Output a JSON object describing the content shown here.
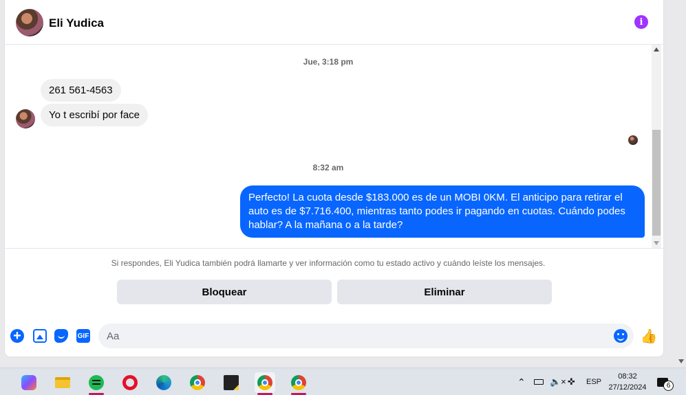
{
  "header": {
    "contact_name": "Eli Yudica"
  },
  "messages": {
    "timestamp_1": "Jue, 3:18 pm",
    "incoming_1": "261 561-4563",
    "incoming_2": "Yo t escribí por face",
    "timestamp_2": "8:32 am",
    "outgoing_1": "Perfecto! La cuota desde $183.000 es de un MOBI 0KM. El anticipo para retirar el auto es de $7.716.400, mientras tanto podes ir pagando en cuotas. Cuándo podes hablar? A la mañana o a la tarde?"
  },
  "block_area": {
    "notice": "Si respondes, Eli Yudica también podrá llamarte y ver información como tu estado activo y cuándo leíste los mensajes.",
    "block_label": "Bloquear",
    "delete_label": "Eliminar"
  },
  "composer": {
    "placeholder": "Aa",
    "gif_label": "GIF"
  },
  "taskbar": {
    "language": "ESP",
    "time": "08:32",
    "date": "27/12/2024",
    "notification_count": "6"
  },
  "colors": {
    "accent": "#0866ff",
    "info": "#a033ff",
    "incoming_bubble": "#f0f0f0"
  }
}
